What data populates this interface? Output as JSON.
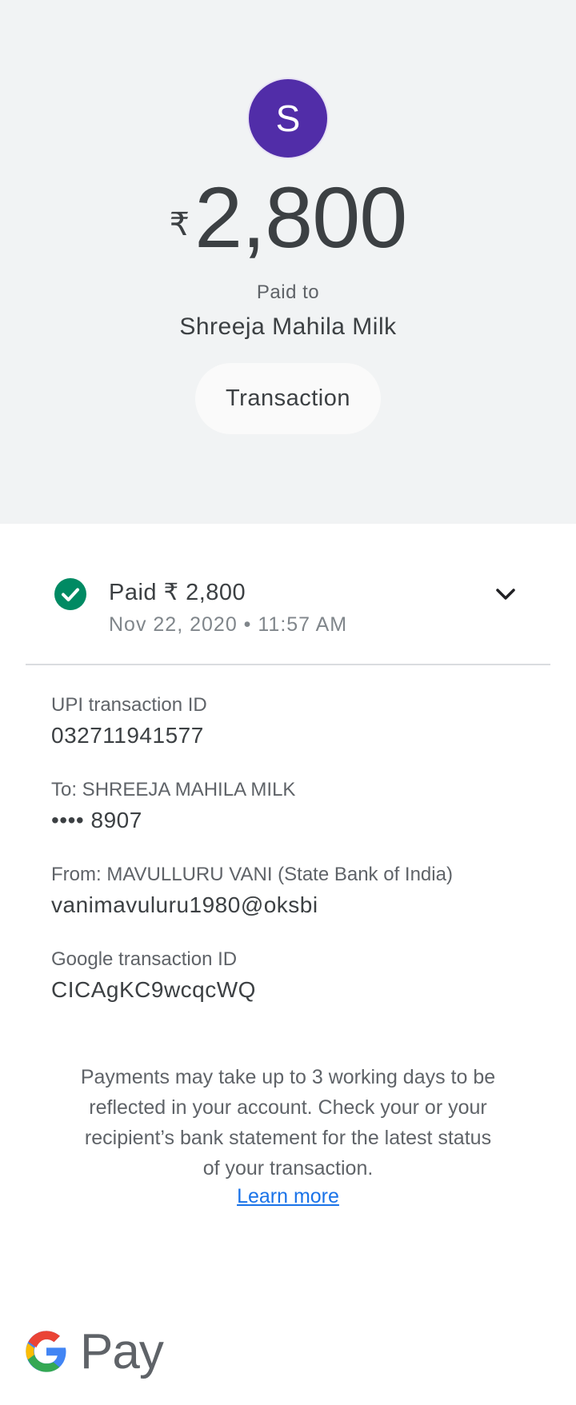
{
  "header": {
    "avatar_letter": "S",
    "avatar_color": "#512da8",
    "currency_symbol": "₹",
    "amount": "2,800",
    "paid_to_label": "Paid to",
    "payee_name": "Shreeja Mahila Milk",
    "transaction_button": "Transaction"
  },
  "status": {
    "icon": "check-circle-icon",
    "title": "Paid ₹ 2,800",
    "datetime": "Nov 22, 2020 • 11:57 AM",
    "expand_icon": "chevron-down-icon"
  },
  "details": [
    {
      "label": "UPI transaction ID",
      "value": "032711941577"
    },
    {
      "label": "To: SHREEJA MAHILA MILK",
      "value": "•••• 8907"
    },
    {
      "label": "From: MAVULLURU  VANI (State Bank of India)",
      "value": "vanimavuluru1980@oksbi"
    },
    {
      "label": "Google transaction ID",
      "value": "CICAgKC9wcqcWQ"
    }
  ],
  "footer": {
    "note": "Payments may take up to 3 working days to be reflected in your account. Check your or your recipient’s bank statement for the latest status of your transaction.",
    "learn_more": "Learn more",
    "brand_text": "Pay",
    "accent_color": "#1a73e8",
    "success_color": "#008a63"
  }
}
